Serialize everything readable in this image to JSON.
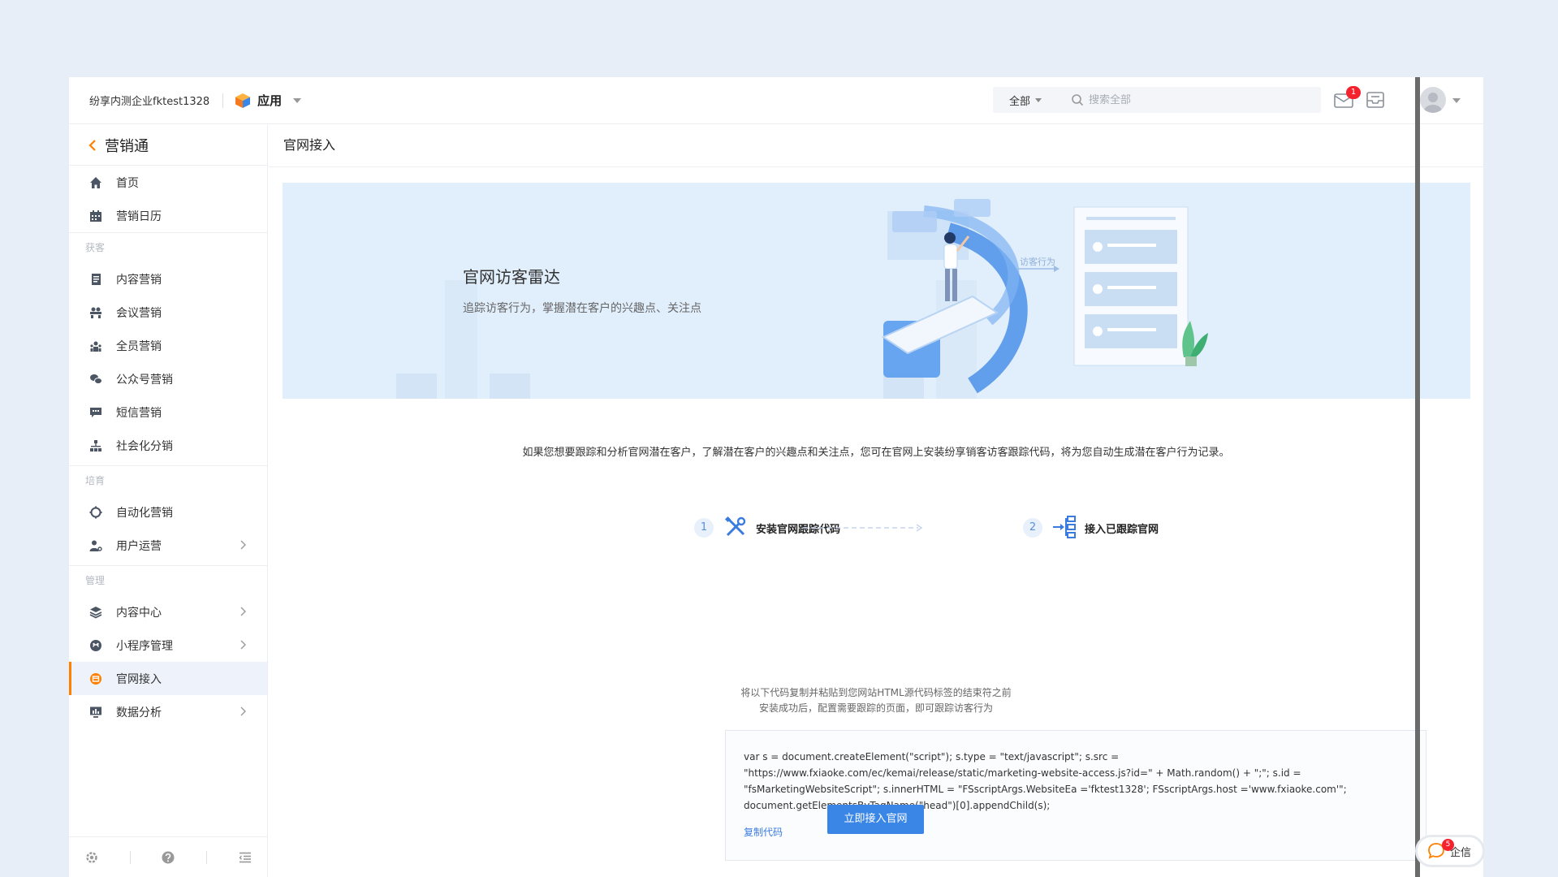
{
  "topbar": {
    "company": "纷享内测企业fktest1328",
    "app_switch_label": "应用",
    "search_scope": "全部",
    "search_placeholder": "搜索全部",
    "message_badge": "1"
  },
  "sidebar": {
    "title": "营销通",
    "top_items": [
      {
        "label": "首页",
        "icon": "home-icon"
      },
      {
        "label": "营销日历",
        "icon": "calendar-icon"
      }
    ],
    "groups": [
      {
        "title": "获客",
        "items": [
          {
            "label": "内容营销",
            "icon": "document-icon"
          },
          {
            "label": "会议营销",
            "icon": "meeting-icon"
          },
          {
            "label": "全员营销",
            "icon": "team-icon"
          },
          {
            "label": "公众号营销",
            "icon": "wechat-icon"
          },
          {
            "label": "短信营销",
            "icon": "sms-icon"
          },
          {
            "label": "社会化分销",
            "icon": "org-tree-icon"
          }
        ]
      },
      {
        "title": "培育",
        "items": [
          {
            "label": "自动化营销",
            "icon": "automation-icon"
          },
          {
            "label": "用户运营",
            "icon": "user-ops-icon"
          }
        ]
      },
      {
        "title": "管理",
        "items": [
          {
            "label": "内容中心",
            "icon": "layers-icon"
          },
          {
            "label": "小程序管理",
            "icon": "miniprogram-icon"
          },
          {
            "label": "官网接入",
            "icon": "website-icon"
          },
          {
            "label": "数据分析",
            "icon": "monitor-icon"
          }
        ]
      }
    ]
  },
  "main": {
    "page_title": "官网接入",
    "banner": {
      "title": "官网访客雷达",
      "subtitle": "追踪访客行为，掌握潜在客户的兴趣点、关注点",
      "art_label": "访客行为"
    },
    "intro": "如果您想要跟踪和分析官网潜在客户，了解潜在客户的兴趣点和关注点，您可在官网上安装纷享销客访客跟踪代码，将为您自动生成潜在客户行为记录。",
    "steps": [
      {
        "num": "1",
        "label": "安装官网跟踪代码"
      },
      {
        "num": "2",
        "label": "接入已跟踪官网"
      }
    ],
    "hint_line1": "将以下代码复制并粘贴到您网站HTML源代码标签的结束符之前",
    "hint_line2": "安装成功后，配置需要跟踪的页面，即可跟踪访客行为",
    "code_lines": [
      "var s = document.createElement(\"script\"); s.type = \"text/javascript\"; s.src =",
      "\"https://www.fxiaoke.com/ec/kemai/release/static/marketing-website-access.js?id=\" + Math.random() + \";\"; s.id =",
      "\"fsMarketingWebsiteScript\"; s.innerHTML = \"FSscriptArgs.WebsiteEa ='fktest1328'; FSscriptArgs.host ='www.fxiaoke.com'\";",
      "document.getElementsByTagName(\"head\")[0].appendChild(s);"
    ],
    "copy_label": "复制代码",
    "cta_label": "立即接入官网"
  },
  "qixin": {
    "label": "企信",
    "badge": "5"
  },
  "colors": {
    "accent": "#3a86e6",
    "active_bar": "#ff8000",
    "banner_bg": "#e1eefb"
  }
}
